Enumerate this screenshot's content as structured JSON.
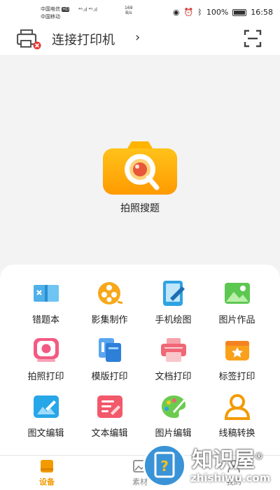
{
  "status_bar": {
    "carrier_1": "中国电信",
    "carrier_2": "中国移动",
    "hd_badge": "HD",
    "signal_text": "⁴ᴳ.ıl ⁴ᴳ.ıl",
    "speed_value": "169",
    "speed_unit": "B/s",
    "battery": "100%",
    "time": "16:58"
  },
  "header": {
    "title": "连接打印机",
    "chevron": "›"
  },
  "main": {
    "camera_label": "拍照搜题"
  },
  "features": [
    {
      "label": "错题本",
      "icon": "mistake-book-icon"
    },
    {
      "label": "影集制作",
      "icon": "film-reel-icon"
    },
    {
      "label": "手机绘图",
      "icon": "tablet-draw-icon"
    },
    {
      "label": "图片作品",
      "icon": "picture-icon"
    },
    {
      "label": "拍照打印",
      "icon": "photo-print-icon"
    },
    {
      "label": "模版打印",
      "icon": "template-print-icon"
    },
    {
      "label": "文档打印",
      "icon": "doc-print-icon"
    },
    {
      "label": "标签打印",
      "icon": "label-print-icon"
    },
    {
      "label": "图文编辑",
      "icon": "image-text-edit-icon"
    },
    {
      "label": "文本编辑",
      "icon": "text-edit-icon"
    },
    {
      "label": "图片编辑",
      "icon": "palette-icon"
    },
    {
      "label": "线稿转换",
      "icon": "line-art-icon"
    }
  ],
  "nav": {
    "tabs": [
      {
        "label": "设备",
        "active": true
      },
      {
        "label": "素材",
        "active": false
      },
      {
        "label": "我的",
        "active": false
      }
    ]
  },
  "watermark": {
    "title": "知识屋",
    "registered": "®",
    "subtitle": "zhishiwu.com"
  },
  "colors": {
    "accent": "#f39a00",
    "panel": "#ffffff",
    "background": "#f3f3f3"
  }
}
